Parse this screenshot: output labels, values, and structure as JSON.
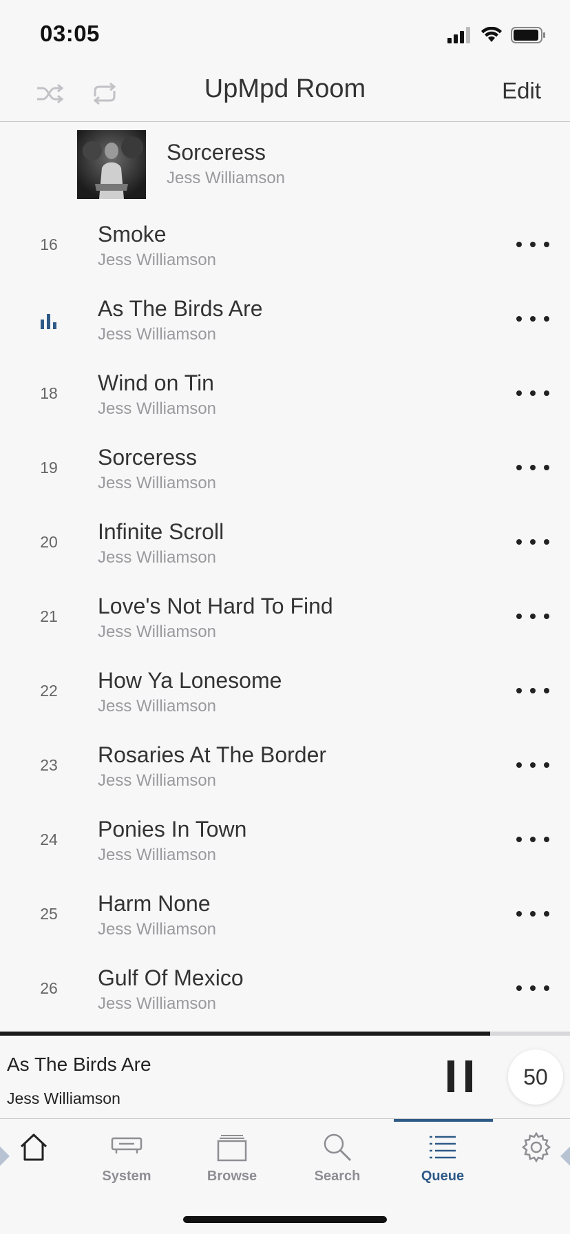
{
  "status_bar": {
    "time": "03:05"
  },
  "nav": {
    "title": "UpMpd Room",
    "edit_label": "Edit"
  },
  "current_header": {
    "title": "Sorceress",
    "artist": "Jess Williamson"
  },
  "queue": {
    "rows": [
      {
        "num": "16",
        "title": "Smoke",
        "artist": "Jess Williamson",
        "playing": false
      },
      {
        "num": "",
        "title": "As The Birds Are",
        "artist": "Jess Williamson",
        "playing": true
      },
      {
        "num": "18",
        "title": "Wind on Tin",
        "artist": "Jess Williamson",
        "playing": false
      },
      {
        "num": "19",
        "title": "Sorceress",
        "artist": "Jess Williamson",
        "playing": false
      },
      {
        "num": "20",
        "title": "Infinite Scroll",
        "artist": "Jess Williamson",
        "playing": false
      },
      {
        "num": "21",
        "title": "Love's Not Hard To Find",
        "artist": "Jess Williamson",
        "playing": false
      },
      {
        "num": "22",
        "title": "How Ya Lonesome",
        "artist": "Jess Williamson",
        "playing": false
      },
      {
        "num": "23",
        "title": "Rosaries At The Border",
        "artist": "Jess Williamson",
        "playing": false
      },
      {
        "num": "24",
        "title": "Ponies In Town",
        "artist": "Jess Williamson",
        "playing": false
      },
      {
        "num": "25",
        "title": "Harm None",
        "artist": "Jess Williamson",
        "playing": false
      },
      {
        "num": "26",
        "title": "Gulf Of Mexico",
        "artist": "Jess Williamson",
        "playing": false
      }
    ]
  },
  "playback": {
    "progress": 0.86
  },
  "mini_player": {
    "title": "As The Birds Are",
    "artist": "Jess Williamson",
    "volume": "50"
  },
  "tabs": {
    "home": {
      "label": ""
    },
    "system": {
      "label": "System"
    },
    "browse": {
      "label": "Browse"
    },
    "search": {
      "label": "Search"
    },
    "queue": {
      "label": "Queue"
    },
    "settings": {
      "label": ""
    }
  },
  "colors": {
    "accent": "#2e5a87",
    "inactive_icon": "#c2c2c6",
    "text_secondary": "#9a9a9e"
  }
}
